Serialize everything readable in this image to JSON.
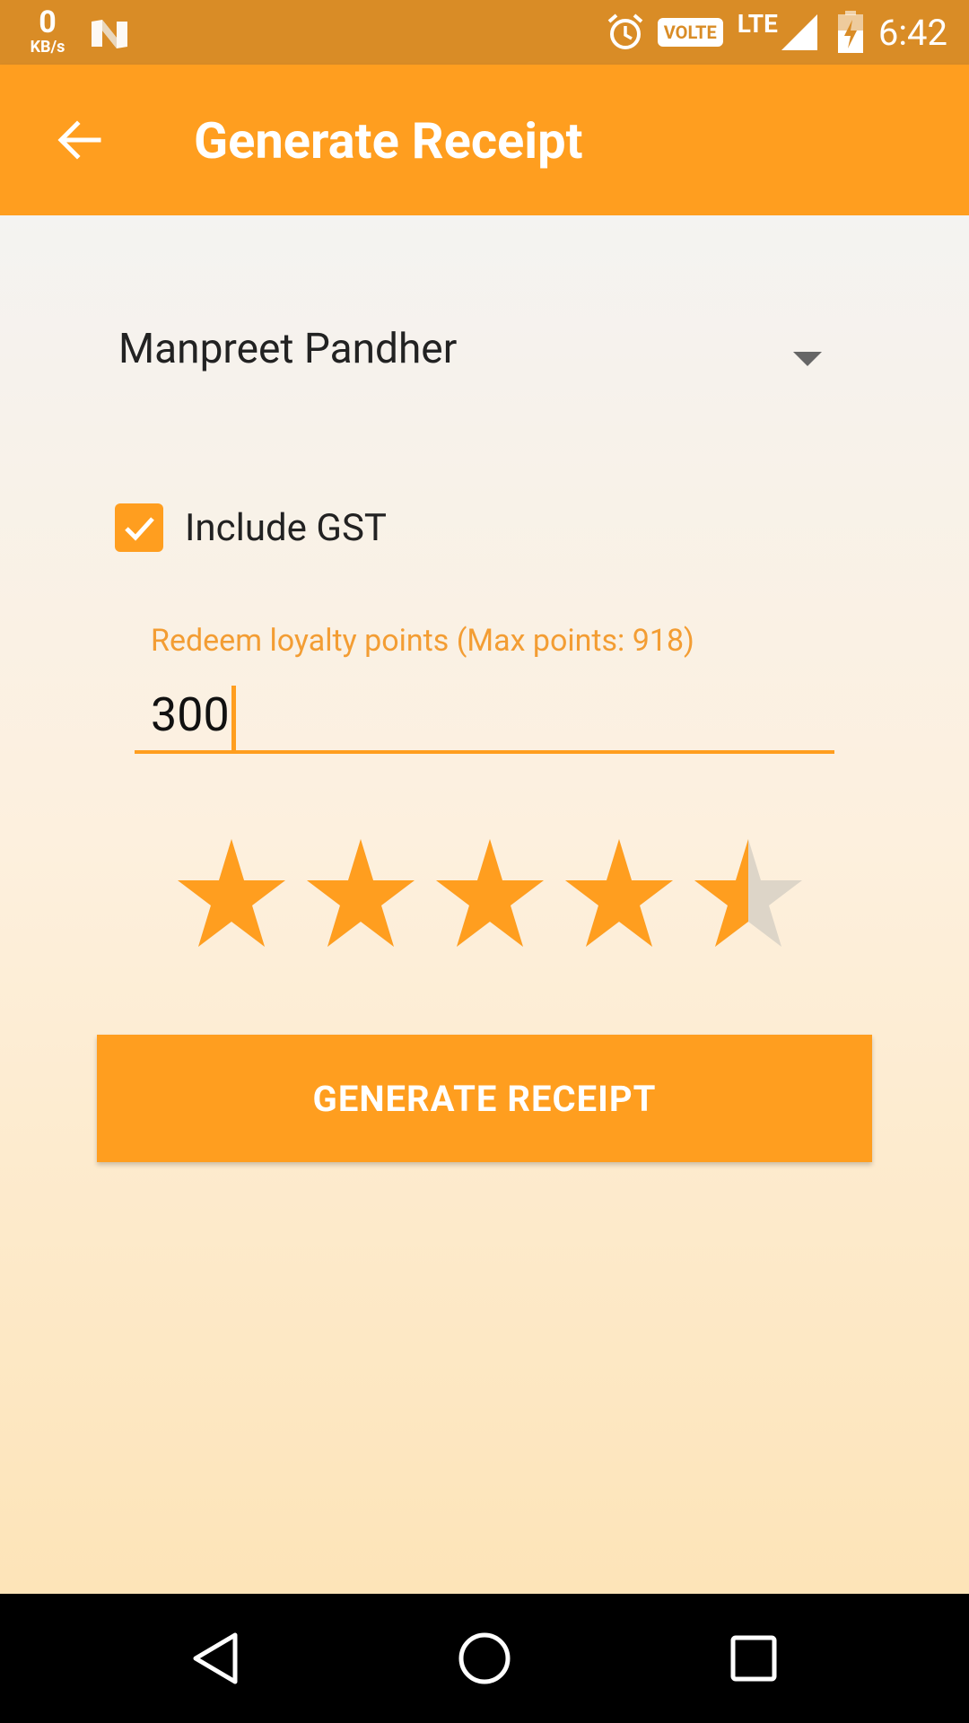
{
  "status_bar": {
    "speed_value": "0",
    "speed_unit": "KB/s",
    "volte": "VOLTE",
    "network": "LTE",
    "time": "6:42"
  },
  "app_bar": {
    "title": "Generate Receipt"
  },
  "form": {
    "customer_selected": "Manpreet Pandher",
    "gst_label": "Include GST",
    "gst_checked": true,
    "loyalty_label": "Redeem loyalty points (Max points: 918)",
    "loyalty_value": "300",
    "rating": 4.5,
    "rating_max": 5,
    "submit_label": "GENERATE RECEIPT"
  },
  "colors": {
    "accent": "#ff9e1f",
    "status_bar": "#d98c26",
    "hint": "#f39d33",
    "star_empty": "#ddd5c8"
  },
  "icons": {
    "back": "arrow-back-icon",
    "nav_back": "triangle-back-icon",
    "nav_home": "circle-home-icon",
    "nav_recents": "square-recents-icon"
  }
}
